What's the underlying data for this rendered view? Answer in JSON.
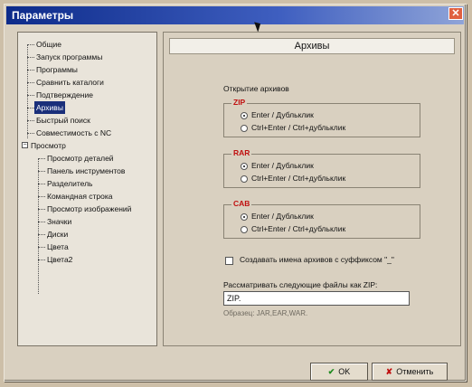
{
  "window": {
    "title": "Параметры"
  },
  "tree": {
    "items": [
      {
        "label": "Общие"
      },
      {
        "label": "Запуск программы"
      },
      {
        "label": "Программы"
      },
      {
        "label": "Сравнить каталоги"
      },
      {
        "label": "Подтверждение"
      },
      {
        "label": "Архивы",
        "selected": true
      },
      {
        "label": "Быстрый поиск"
      },
      {
        "label": "Совместимость с NC"
      },
      {
        "label": "Просмотр",
        "expandable": true,
        "expander": "−"
      },
      {
        "label": "Просмотр деталей"
      },
      {
        "label": "Панель инструментов"
      },
      {
        "label": "Разделитель"
      },
      {
        "label": "Командная строка"
      },
      {
        "label": "Просмотр изображений"
      },
      {
        "label": "Значки"
      },
      {
        "label": "Диски"
      },
      {
        "label": "Цвета"
      },
      {
        "label": "Цвета2"
      }
    ]
  },
  "panel": {
    "header": "Архивы",
    "open_archives_label": "Открытие архивов",
    "groups": [
      {
        "title": "ZIP",
        "options": [
          "Enter / Дубльклик",
          "Ctrl+Enter / Ctrl+дубльклик"
        ],
        "selected_index": 0
      },
      {
        "title": "RAR",
        "options": [
          "Enter / Дубльклик",
          "Ctrl+Enter / Ctrl+дубльклик"
        ],
        "selected_index": 0
      },
      {
        "title": "CAB",
        "options": [
          "Enter / Дубльклик",
          "Ctrl+Enter / Ctrl+дубльклик"
        ],
        "selected_index": 0
      }
    ],
    "suffix_checkbox_label": "Создавать имена архивов с суффиксом \"_\"",
    "suffix_checked": false,
    "zip_treat_label": "Рассматривать следующие файлы как ZIP:",
    "zip_input_value": "ZIP.",
    "sample_text": "Образец: JAR,EAR,WAR."
  },
  "buttons": {
    "ok_label": "OK",
    "ok_icon": "check-icon",
    "cancel_label": "Отменить",
    "cancel_icon": "cross-icon"
  },
  "colors": {
    "title_bar": "#0d2b8a",
    "selection": "#1a2f7a",
    "group_title": "#c01010"
  }
}
